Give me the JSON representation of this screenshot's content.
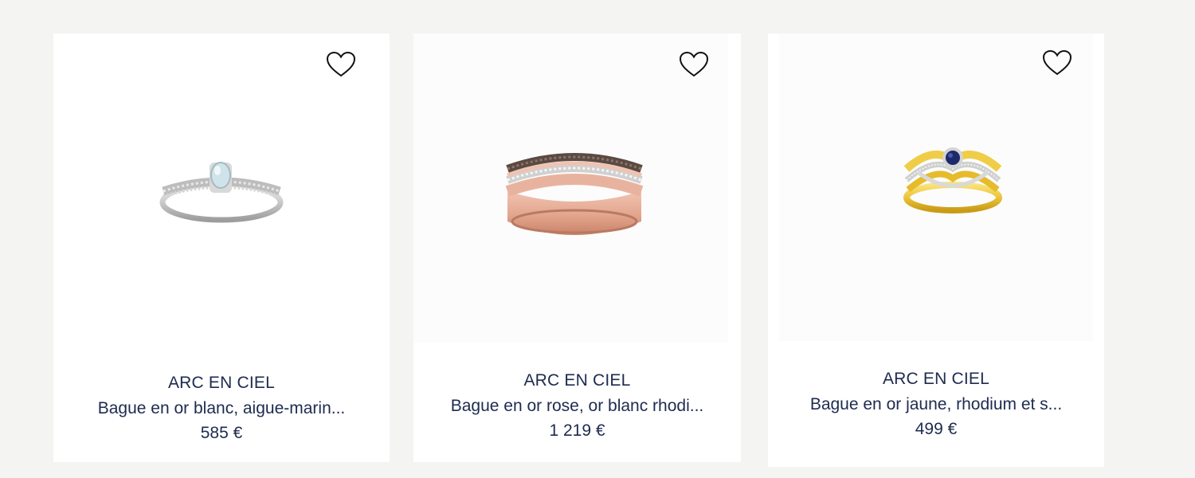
{
  "products": [
    {
      "brand": "ARC EN CIEL",
      "name": "Bague en or blanc, aigue-marin...",
      "price": "585 €",
      "favorite_icon": "heart-outline-icon"
    },
    {
      "brand": "ARC EN CIEL",
      "name": "Bague en or rose, or blanc rhodi...",
      "price": "1 219 €",
      "favorite_icon": "heart-outline-icon"
    },
    {
      "brand": "ARC EN CIEL",
      "name": "Bague en or jaune, rhodium et s...",
      "price": "499 €",
      "favorite_icon": "heart-outline-icon"
    }
  ],
  "colors": {
    "page_background": "#f4f4f2",
    "card_background": "#ffffff",
    "text": "#1d2b4f"
  }
}
